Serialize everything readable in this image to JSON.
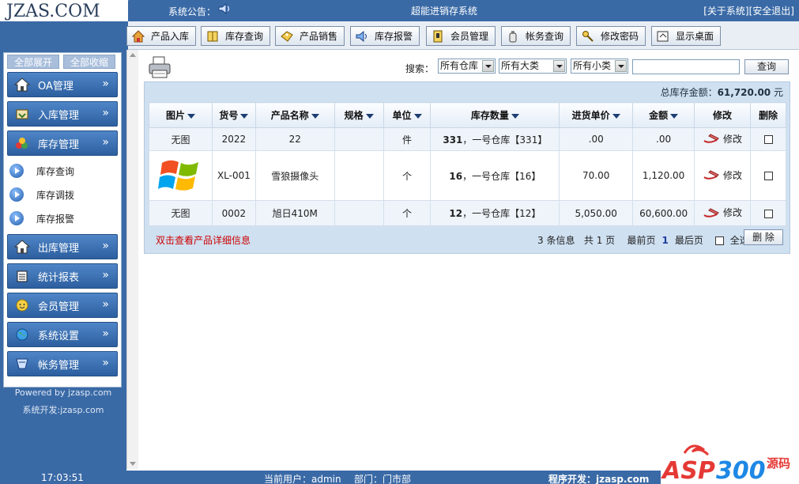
{
  "header": {
    "logo": "JZAS.COM",
    "announce_label": "系统公告：",
    "system_title": "超能进销存系统",
    "links": [
      "[关于系统]",
      "[安全退出]"
    ]
  },
  "topnav": [
    {
      "label": "产品入库",
      "icon": "home-icon"
    },
    {
      "label": "库存查询",
      "icon": "book-icon"
    },
    {
      "label": "产品销售",
      "icon": "tag-icon"
    },
    {
      "label": "库存报警",
      "icon": "speaker-icon"
    },
    {
      "label": "会员管理",
      "icon": "card-icon"
    },
    {
      "label": "帐务查询",
      "icon": "bottle-icon"
    },
    {
      "label": "修改密码",
      "icon": "key-icon"
    },
    {
      "label": "显示桌面",
      "icon": "desktop-icon"
    }
  ],
  "sidebar": {
    "expand_all": "全部展开",
    "collapse_all": "全部收缩",
    "menus": [
      {
        "label": "OA管理",
        "icon": "home-icon"
      },
      {
        "label": "入库管理",
        "icon": "inbox-icon"
      },
      {
        "label": "库存管理",
        "icon": "stock-icon"
      }
    ],
    "sub_items": [
      "库存查询",
      "库存调拨",
      "库存报警"
    ],
    "menus_bottom": [
      {
        "label": "出库管理",
        "icon": "home-icon"
      },
      {
        "label": "统计报表",
        "icon": "report-icon"
      },
      {
        "label": "会员管理",
        "icon": "member-icon"
      },
      {
        "label": "系统设置",
        "icon": "globe-icon"
      },
      {
        "label": "帐务管理",
        "icon": "account-icon"
      }
    ],
    "powered_by": "Powered by jzasp.com",
    "developer": "系统开发:jzasp.com"
  },
  "search": {
    "label": "搜索：",
    "warehouse": "所有仓库",
    "category": "所有大类",
    "subcategory": "所有小类",
    "input_value": "",
    "button": "查询"
  },
  "total": {
    "label": "总库存金额：",
    "value": "61,720.00",
    "unit": "元"
  },
  "table": {
    "headers": [
      "图片",
      "货号",
      "产品名称",
      "规格",
      "单位",
      "库存数量",
      "进货单价",
      "金额",
      "修改",
      "删除"
    ],
    "rows": [
      {
        "image": "无图",
        "code": "2022",
        "name": "22",
        "spec": "",
        "unit": "件",
        "qty": "331",
        "qty_detail": "，一号仓库【331】",
        "price": ".00",
        "amount": ".00",
        "edit": "修改"
      },
      {
        "image": "",
        "code": "XL-001",
        "name": "雪狼摄像头",
        "spec": "",
        "unit": "个",
        "qty": "16",
        "qty_detail": "，一号仓库【16】",
        "price": "70.00",
        "amount": "1,120.00",
        "edit": "修改"
      },
      {
        "image": "无图",
        "code": "0002",
        "name": "旭日410M",
        "spec": "",
        "unit": "个",
        "qty": "12",
        "qty_detail": "，一号仓库【12】",
        "price": "5,050.00",
        "amount": "60,600.00",
        "edit": "修改"
      }
    ]
  },
  "footer": {
    "hint": "双击查看产品详细信息",
    "records": "3 条信息",
    "pages": "共 1 页",
    "first": "最前页",
    "current_page": "1",
    "last": "最后页",
    "select_all": "全选",
    "delete_button": "删 除"
  },
  "statusbar": {
    "time": "17:03:51",
    "user": "当前用户：admin",
    "dept": "部门：门市部",
    "developer": "程序开发：jzasp.com"
  },
  "watermark": "ASP300源码"
}
